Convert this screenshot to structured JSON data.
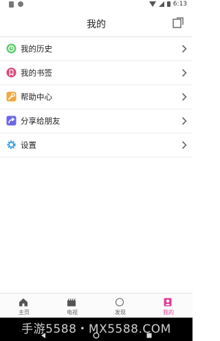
{
  "status_bar": {
    "time": "6:13"
  },
  "header": {
    "title": "我的",
    "share_icon": "share-icon"
  },
  "menu": [
    {
      "label": "我的历史",
      "icon": "history-icon",
      "color": "#5ccf6a"
    },
    {
      "label": "我的书签",
      "icon": "bookmark-icon",
      "color": "#e0457b"
    },
    {
      "label": "帮助中心",
      "icon": "wrench-icon",
      "color": "#f2a83b"
    },
    {
      "label": "分享给朋友",
      "icon": "share-arrow-icon",
      "color": "#6a67e8"
    },
    {
      "label": "设置",
      "icon": "gear-icon",
      "color": "#2f9be3"
    }
  ],
  "tabs": [
    {
      "label": "主页",
      "icon": "home-icon",
      "active": false
    },
    {
      "label": "电视",
      "icon": "tv-icon",
      "active": false
    },
    {
      "label": "发现",
      "icon": "discover-icon",
      "active": false
    },
    {
      "label": "我的",
      "icon": "profile-icon",
      "active": true
    }
  ],
  "accent_color": "#e0409a",
  "watermark": "手游5588・MX5588.COM"
}
